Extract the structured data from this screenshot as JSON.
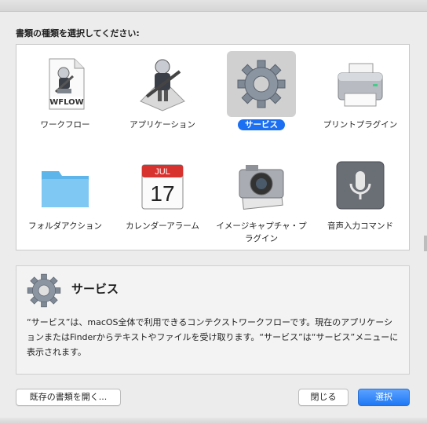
{
  "prompt": "書類の種類を選択してください:",
  "doc_types": [
    {
      "label": "ワークフロー",
      "icon": "workflow-file-icon",
      "file_badge": "WFLOW"
    },
    {
      "label": "アプリケーション",
      "icon": "automator-app-icon"
    },
    {
      "label": "サービス",
      "icon": "gear-icon",
      "selected": true
    },
    {
      "label": "プリントプラグイン",
      "icon": "printer-icon"
    },
    {
      "label": "フォルダアクション",
      "icon": "folder-icon"
    },
    {
      "label": "カレンダーアラーム",
      "icon": "calendar-icon",
      "cal_month": "JUL",
      "cal_day": "17"
    },
    {
      "label": "イメージキャプチャ・プラグイン",
      "icon": "camera-icon"
    },
    {
      "label": "音声入力コマンド",
      "icon": "microphone-icon"
    }
  ],
  "description": {
    "title": "サービス",
    "text": "“サービス”は、macOS全体で利用できるコンテクストワークフローです。現在のアプリケーションまたはFinderからテキストやファイルを受け取ります。“サービス”は“サービス”メニューに表示されます。"
  },
  "buttons": {
    "open_existing": "既存の書類を開く...",
    "close": "閉じる",
    "choose": "選択"
  },
  "colors": {
    "accent": "#1b6ff2",
    "selected_tile_bg": "#d0d0d0"
  }
}
